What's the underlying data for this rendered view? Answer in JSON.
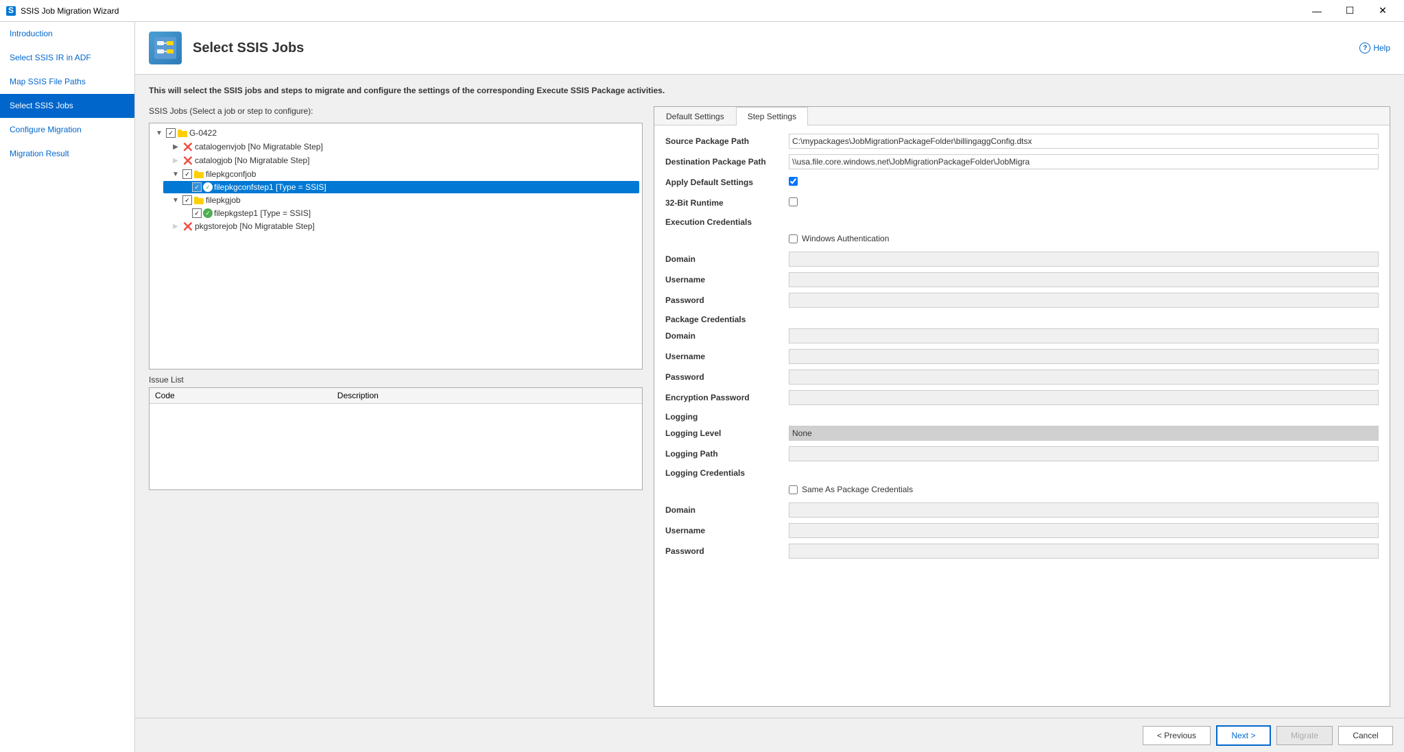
{
  "titleBar": {
    "title": "SSIS Job Migration Wizard",
    "controls": [
      "minimize",
      "maximize",
      "close"
    ]
  },
  "sidebar": {
    "items": [
      {
        "id": "introduction",
        "label": "Introduction",
        "active": false
      },
      {
        "id": "select-ssis-ir",
        "label": "Select SSIS IR in ADF",
        "active": false
      },
      {
        "id": "map-file-paths",
        "label": "Map SSIS File Paths",
        "active": false
      },
      {
        "id": "select-ssis-jobs",
        "label": "Select SSIS Jobs",
        "active": true
      },
      {
        "id": "configure-migration",
        "label": "Configure Migration",
        "active": false
      },
      {
        "id": "migration-result",
        "label": "Migration Result",
        "active": false
      }
    ]
  },
  "pageHeader": {
    "title": "Select SSIS Jobs",
    "helpLabel": "Help"
  },
  "description": "This will select the SSIS jobs and steps to migrate and configure the settings of the corresponding Execute SSIS Package activities.",
  "jobsPanel": {
    "label": "SSIS Jobs (Select a job or step to configure):",
    "nodes": [
      {
        "id": "root",
        "indent": 0,
        "expand": true,
        "checkbox": "checked",
        "icon": "folder",
        "label": "G-0422",
        "status": null
      },
      {
        "id": "catalogenvjob",
        "indent": 1,
        "expand": true,
        "checkbox": "none",
        "icon": "error",
        "label": "catalogenvjob [No Migratable Step]",
        "status": "error"
      },
      {
        "id": "catalogjob",
        "indent": 1,
        "expand": false,
        "checkbox": "none",
        "icon": "error",
        "label": "catalogjob [No Migratable Step]",
        "status": "error"
      },
      {
        "id": "filepkgconfjob",
        "indent": 1,
        "expand": true,
        "checkbox": "checked",
        "icon": "folder",
        "label": "filepkgconfjob",
        "status": null
      },
      {
        "id": "filepkgconfstep1",
        "indent": 2,
        "expand": false,
        "checkbox": "checked",
        "icon": "success",
        "label": "filepkgconfstep1 [Type = SSIS]",
        "status": "success",
        "selected": true
      },
      {
        "id": "filepkgjob",
        "indent": 1,
        "expand": true,
        "checkbox": "checked",
        "icon": "folder",
        "label": "filepkgjob",
        "status": null
      },
      {
        "id": "filepkgstep1",
        "indent": 2,
        "expand": false,
        "checkbox": "checked",
        "icon": "success",
        "label": "filepkgstep1 [Type = SSIS]",
        "status": "success"
      },
      {
        "id": "pkgstorejob",
        "indent": 1,
        "expand": false,
        "checkbox": "none",
        "icon": "error",
        "label": "pkgstorejob [No Migratable Step]",
        "status": "error"
      }
    ]
  },
  "issueList": {
    "label": "Issue List",
    "columns": [
      "Code",
      "Description"
    ],
    "rows": []
  },
  "settingsTabs": [
    {
      "id": "default-settings",
      "label": "Default Settings"
    },
    {
      "id": "step-settings",
      "label": "Step Settings",
      "active": true
    }
  ],
  "stepSettings": {
    "sourcePackagePath": {
      "label": "Source Package Path",
      "value": "C:\\mypackages\\JobMigrationPackageFolder\\billingaggConfig.dtsx"
    },
    "destinationPackagePath": {
      "label": "Destination Package Path",
      "value": "\\\\usa.file.core.windows.net\\JobMigrationPackageFolder\\JobMigra"
    },
    "applyDefaultSettings": {
      "label": "Apply Default Settings",
      "checked": true
    },
    "runtime32bit": {
      "label": "32-Bit Runtime",
      "checked": false
    },
    "executionCredentials": {
      "label": "Execution Credentials",
      "windowsAuth": false,
      "windowsAuthLabel": "Windows Authentication",
      "domainLabel": "Domain",
      "domain": "",
      "usernameLabel": "Username",
      "username": "",
      "passwordLabel": "Password",
      "password": ""
    },
    "packageCredentials": {
      "label": "Package Credentials",
      "domainLabel": "Domain",
      "domain": "",
      "usernameLabel": "Username",
      "username": "",
      "passwordLabel": "Password",
      "password": "",
      "encryptionPasswordLabel": "Encryption Password",
      "encryptionPassword": ""
    },
    "logging": {
      "label": "Logging",
      "loggingLevelLabel": "Logging Level",
      "loggingLevel": "None",
      "loggingPathLabel": "Logging Path",
      "loggingPath": ""
    },
    "loggingCredentials": {
      "label": "Logging Credentials",
      "sameAsPackageLabel": "Same As Package Credentials",
      "sameAsPackage": false,
      "domainLabel": "Domain",
      "domain": "",
      "usernameLabel": "Username",
      "username": "",
      "passwordLabel": "Password",
      "password": ""
    }
  },
  "footer": {
    "previousLabel": "< Previous",
    "nextLabel": "Next >",
    "migrateLabel": "Migrate",
    "cancelLabel": "Cancel"
  }
}
